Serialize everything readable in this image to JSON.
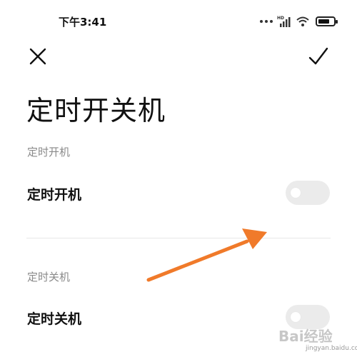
{
  "status_bar": {
    "time": "下午3:41",
    "icons": [
      "more-dots-icon",
      "hd-cellular-signal-icon",
      "wifi-icon",
      "battery-icon"
    ],
    "hd_label": "HD",
    "battery_level": 0.75
  },
  "header": {
    "close_icon": "close-icon",
    "confirm_icon": "checkmark-icon"
  },
  "page": {
    "title": "定时开关机"
  },
  "sections": [
    {
      "header": "定时开机",
      "row_label": "定时开机",
      "toggle_on": false
    },
    {
      "header": "定时关机",
      "row_label": "定时关机",
      "toggle_on": false
    }
  ],
  "overlay": {
    "arrow_color": "#f07a2a"
  },
  "watermark": {
    "brand": "Bai经验",
    "domain": "jingyan.baidu.com"
  },
  "colors": {
    "text": "#111111",
    "section_header": "#8a8a8a",
    "toggle_off": "#ebebeb",
    "divider": "#e8e8e8"
  }
}
